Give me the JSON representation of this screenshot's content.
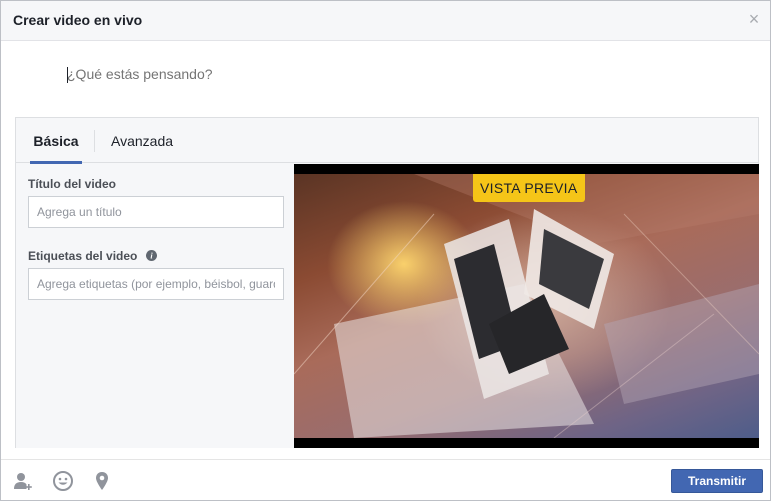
{
  "dialog": {
    "title": "Crear video en vivo",
    "close_icon": "close-icon"
  },
  "composer": {
    "placeholder": "¿Qué estás pensando?"
  },
  "tabs": [
    {
      "label": "Básica",
      "active": true
    },
    {
      "label": "Avanzada",
      "active": false
    }
  ],
  "form": {
    "title_label": "Título del video",
    "title_placeholder": "Agrega un título",
    "tags_label": "Etiquetas del video",
    "tags_info_icon": "info-icon",
    "tags_placeholder": "Agrega etiquetas (por ejemplo, béisbol, guardería)"
  },
  "preview": {
    "badge": "VISTA PREVIA",
    "badge_color": "#f5c518"
  },
  "footer": {
    "icons": [
      "tag-people-icon",
      "emoji-icon",
      "location-pin-icon"
    ],
    "submit_label": "Transmitir",
    "accent": "#4267b2"
  }
}
